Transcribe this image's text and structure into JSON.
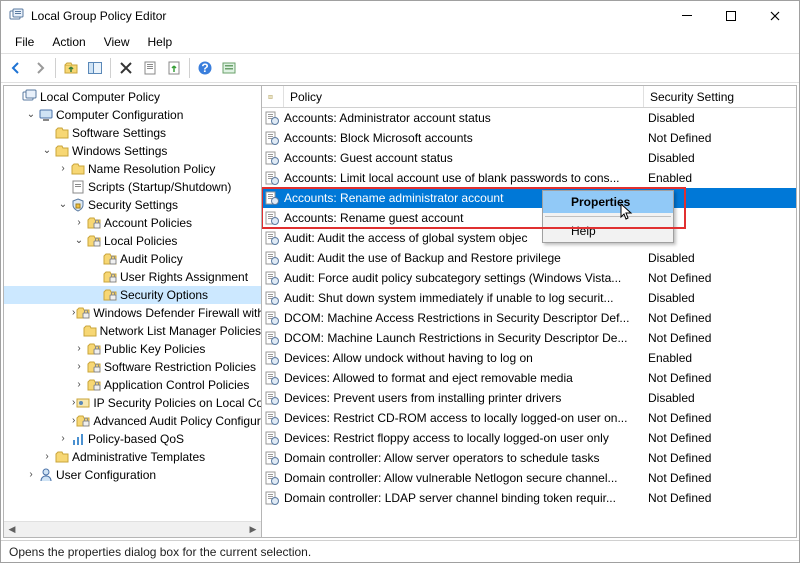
{
  "window": {
    "title": "Local Group Policy Editor"
  },
  "menu": {
    "file": "File",
    "action": "Action",
    "view": "View",
    "help": "Help"
  },
  "tree": [
    {
      "d": 0,
      "tw": "",
      "icon": "root",
      "label": "Local Computer Policy"
    },
    {
      "d": 1,
      "tw": "v",
      "icon": "comp",
      "label": "Computer Configuration"
    },
    {
      "d": 2,
      "tw": "",
      "icon": "folder",
      "label": "Software Settings"
    },
    {
      "d": 2,
      "tw": "v",
      "icon": "folder",
      "label": "Windows Settings"
    },
    {
      "d": 3,
      "tw": ">",
      "icon": "folder",
      "label": "Name Resolution Policy"
    },
    {
      "d": 3,
      "tw": "",
      "icon": "script",
      "label": "Scripts (Startup/Shutdown)"
    },
    {
      "d": 3,
      "tw": "v",
      "icon": "sec",
      "label": "Security Settings",
      "sel": false
    },
    {
      "d": 4,
      "tw": ">",
      "icon": "lfolder",
      "label": "Account Policies"
    },
    {
      "d": 4,
      "tw": "v",
      "icon": "lfolder",
      "label": "Local Policies"
    },
    {
      "d": 5,
      "tw": "",
      "icon": "lfolder",
      "label": "Audit Policy"
    },
    {
      "d": 5,
      "tw": "",
      "icon": "lfolder",
      "label": "User Rights Assignment"
    },
    {
      "d": 5,
      "tw": "",
      "icon": "lfolder",
      "label": "Security Options",
      "sel": true
    },
    {
      "d": 4,
      "tw": ">",
      "icon": "lfolder",
      "label": "Windows Defender Firewall with Advanced Security"
    },
    {
      "d": 4,
      "tw": "",
      "icon": "folder",
      "label": "Network List Manager Policies"
    },
    {
      "d": 4,
      "tw": ">",
      "icon": "lfolder",
      "label": "Public Key Policies"
    },
    {
      "d": 4,
      "tw": ">",
      "icon": "lfolder",
      "label": "Software Restriction Policies"
    },
    {
      "d": 4,
      "tw": ">",
      "icon": "lfolder",
      "label": "Application Control Policies"
    },
    {
      "d": 4,
      "tw": ">",
      "icon": "ipsec",
      "label": "IP Security Policies on Local Computer"
    },
    {
      "d": 4,
      "tw": ">",
      "icon": "lfolder",
      "label": "Advanced Audit Policy Configuration"
    },
    {
      "d": 3,
      "tw": ">",
      "icon": "qos",
      "label": "Policy-based QoS"
    },
    {
      "d": 2,
      "tw": ">",
      "icon": "folder",
      "label": "Administrative Templates"
    },
    {
      "d": 1,
      "tw": ">",
      "icon": "user",
      "label": "User Configuration"
    }
  ],
  "list": {
    "headers": {
      "policy": "Policy",
      "setting": "Security Setting"
    },
    "rows": [
      {
        "p": "Accounts: Administrator account status",
        "s": "Disabled"
      },
      {
        "p": "Accounts: Block Microsoft accounts",
        "s": "Not Defined"
      },
      {
        "p": "Accounts: Guest account status",
        "s": "Disabled"
      },
      {
        "p": "Accounts: Limit local account use of blank passwords to cons...",
        "s": "Enabled"
      },
      {
        "p": "Accounts: Rename administrator account",
        "s": "ator",
        "sel": true
      },
      {
        "p": "Accounts: Rename guest account",
        "s": ""
      },
      {
        "p": "Audit: Audit the access of global system objec",
        "s": ""
      },
      {
        "p": "Audit: Audit the use of Backup and Restore privilege",
        "s": "Disabled"
      },
      {
        "p": "Audit: Force audit policy subcategory settings (Windows Vista...",
        "s": "Not Defined"
      },
      {
        "p": "Audit: Shut down system immediately if unable to log securit...",
        "s": "Disabled"
      },
      {
        "p": "DCOM: Machine Access Restrictions in Security Descriptor Def...",
        "s": "Not Defined"
      },
      {
        "p": "DCOM: Machine Launch Restrictions in Security Descriptor De...",
        "s": "Not Defined"
      },
      {
        "p": "Devices: Allow undock without having to log on",
        "s": "Enabled"
      },
      {
        "p": "Devices: Allowed to format and eject removable media",
        "s": "Not Defined"
      },
      {
        "p": "Devices: Prevent users from installing printer drivers",
        "s": "Disabled"
      },
      {
        "p": "Devices: Restrict CD-ROM access to locally logged-on user on...",
        "s": "Not Defined"
      },
      {
        "p": "Devices: Restrict floppy access to locally logged-on user only",
        "s": "Not Defined"
      },
      {
        "p": "Domain controller: Allow server operators to schedule tasks",
        "s": "Not Defined"
      },
      {
        "p": "Domain controller: Allow vulnerable Netlogon secure channel...",
        "s": "Not Defined"
      },
      {
        "p": "Domain controller: LDAP server channel binding token requir...",
        "s": "Not Defined"
      }
    ]
  },
  "context": {
    "properties": "Properties",
    "help": "Help"
  },
  "status": "Opens the properties dialog box for the current selection."
}
